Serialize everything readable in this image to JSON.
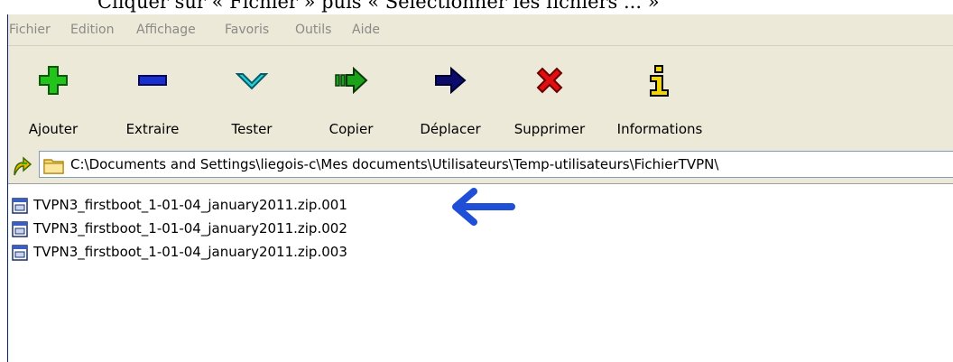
{
  "caption": {
    "text": "Cliquer sur « Fichier » puis « Sélectionner les fichiers ... »"
  },
  "menu": {
    "items": [
      "Fichier",
      "Edition",
      "Affichage",
      "Favoris",
      "Outils",
      "Aide"
    ]
  },
  "toolbar": {
    "buttons": [
      {
        "label": "Ajouter",
        "icon": "plus-icon",
        "color": "#22c31a"
      },
      {
        "label": "Extraire",
        "icon": "minus-icon",
        "color": "#1a2fcf"
      },
      {
        "label": "Tester",
        "icon": "check-chevron-icon",
        "color": "#22d3d6"
      },
      {
        "label": "Copier",
        "icon": "copy-arrow-icon",
        "color": "#1aa31a"
      },
      {
        "label": "Déplacer",
        "icon": "arrow-right-icon",
        "color": "#0b0b6b"
      },
      {
        "label": "Supprimer",
        "icon": "delete-x-icon",
        "color": "#e01010"
      },
      {
        "label": "Informations",
        "icon": "info-icon",
        "color": "#f2d400"
      }
    ]
  },
  "address": {
    "path": "C:\\Documents and Settings\\liegois-c\\Mes documents\\Utilisateurs\\Temp-utilisateurs\\FichierTVPN\\"
  },
  "files": [
    {
      "name": "TVPN3_firstboot_1-01-04_january2011.zip.001"
    },
    {
      "name": "TVPN3_firstboot_1-01-04_january2011.zip.002"
    },
    {
      "name": "TVPN3_firstboot_1-01-04_january2011.zip.003"
    }
  ],
  "annotation": {
    "arrow_color": "#1f4fd6"
  }
}
